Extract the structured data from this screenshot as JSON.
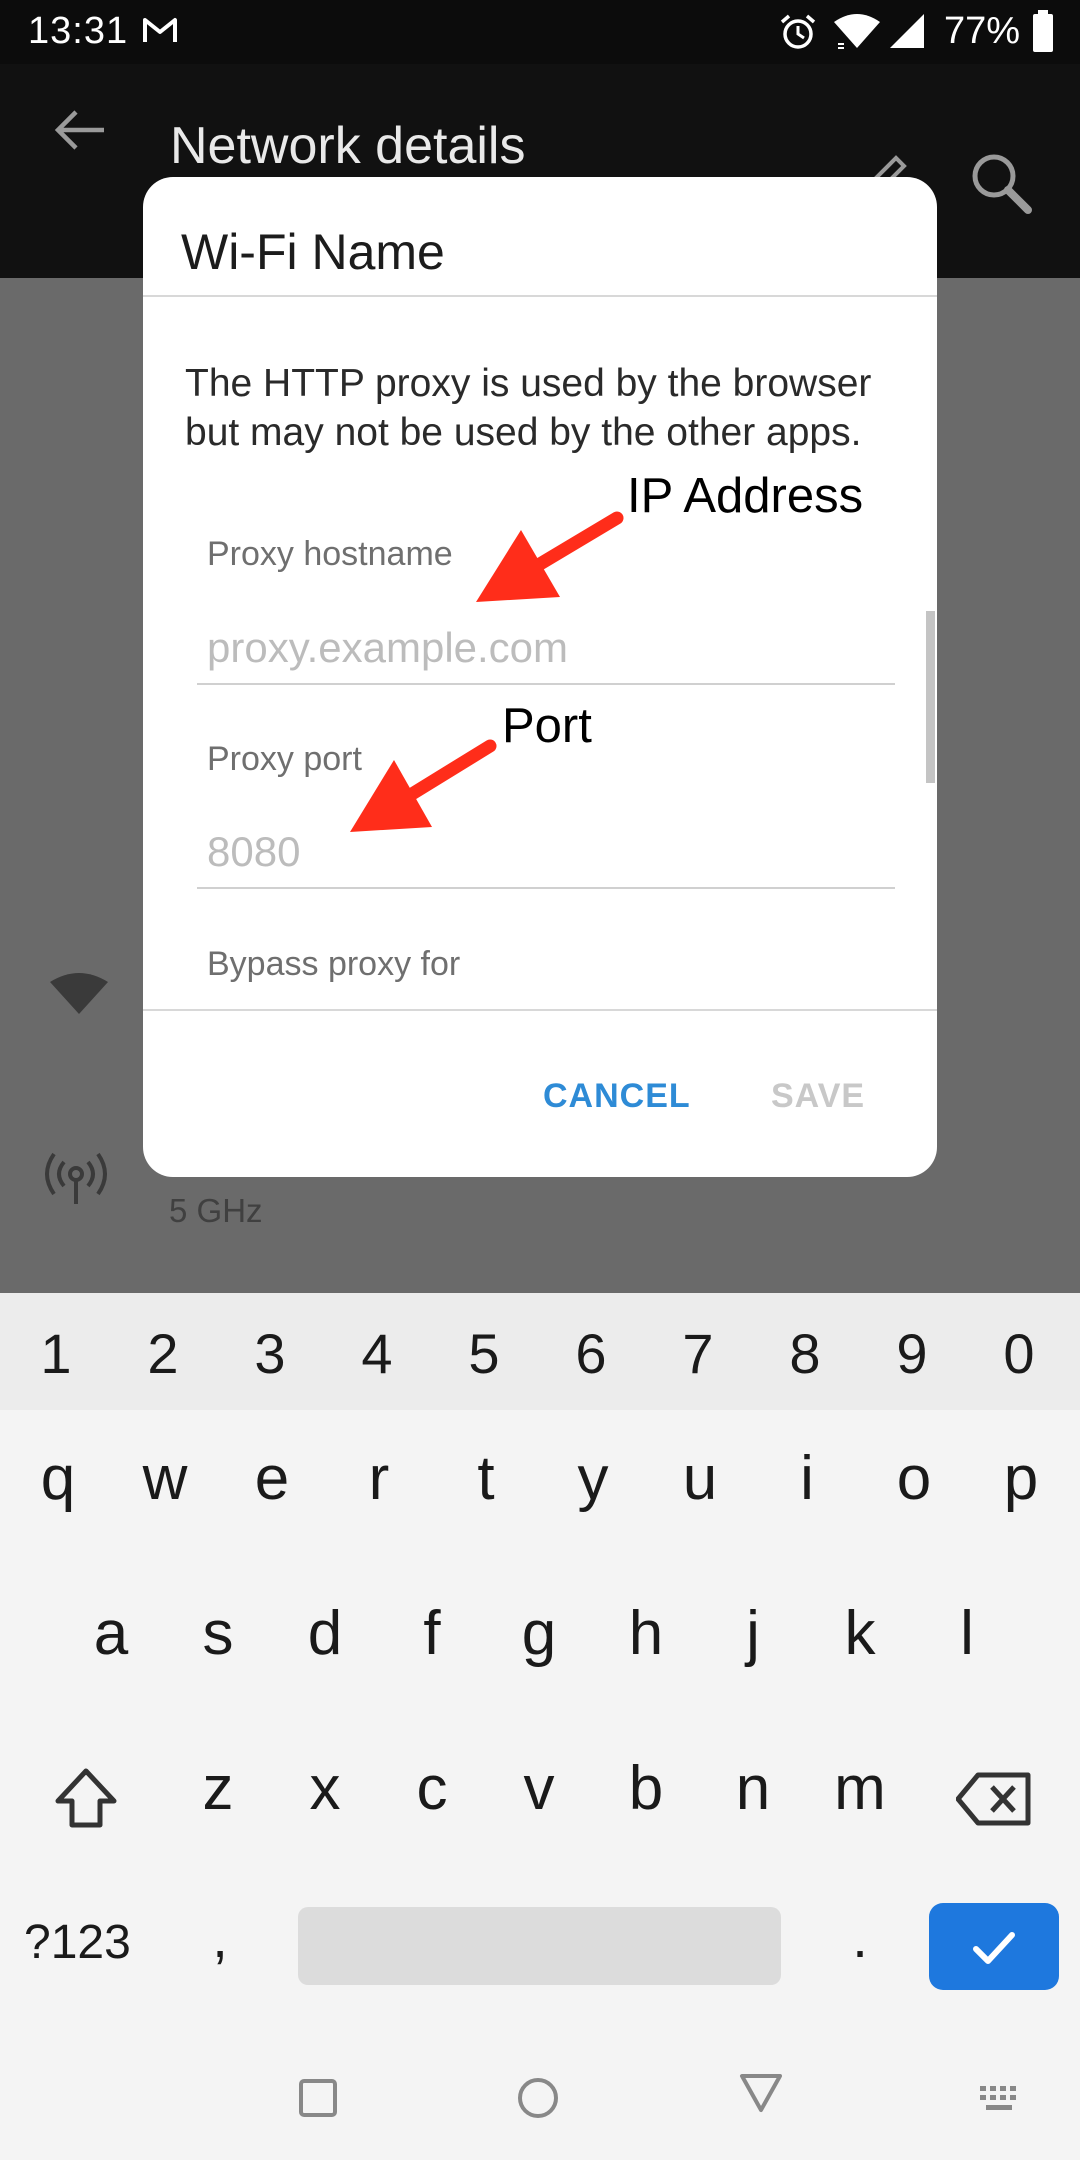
{
  "status_bar": {
    "time": "13:31",
    "battery": "77%",
    "icons": [
      "gmail-icon",
      "alarm-icon",
      "wifi-icon",
      "signal-icon",
      "battery-icon"
    ]
  },
  "background_app": {
    "title": "Network details",
    "secondary_text": "5 GHz",
    "icons": [
      "back-arrow-icon",
      "edit-icon",
      "search-icon",
      "wifi-icon",
      "antenna-icon"
    ]
  },
  "dialog": {
    "title": "Wi-Fi Name",
    "message": "The HTTP proxy is used by the browser but may not be used by the other apps.",
    "fields": {
      "hostname": {
        "label": "Proxy hostname",
        "placeholder": "proxy.example.com",
        "value": ""
      },
      "port": {
        "label": "Proxy port",
        "placeholder": "8080",
        "value": ""
      },
      "bypass": {
        "label": "Bypass proxy for"
      }
    },
    "buttons": {
      "cancel": "CANCEL",
      "save": "SAVE"
    }
  },
  "annotations": {
    "ip_address": "IP Address",
    "port": "Port",
    "arrow_color": "#ff2d1a"
  },
  "keyboard": {
    "number_row": [
      "1",
      "2",
      "3",
      "4",
      "5",
      "6",
      "7",
      "8",
      "9",
      "0"
    ],
    "row1": [
      "q",
      "w",
      "e",
      "r",
      "t",
      "y",
      "u",
      "i",
      "o",
      "p"
    ],
    "row2": [
      "a",
      "s",
      "d",
      "f",
      "g",
      "h",
      "j",
      "k",
      "l"
    ],
    "row3": [
      "z",
      "x",
      "c",
      "v",
      "b",
      "n",
      "m"
    ],
    "symbols": "?123",
    "comma": ",",
    "period": ".",
    "enter_color": "#1e78de"
  },
  "colors": {
    "accent": "#2e8bd6",
    "disabled": "#c8c8c8",
    "scrim": "#6a6a6a"
  }
}
